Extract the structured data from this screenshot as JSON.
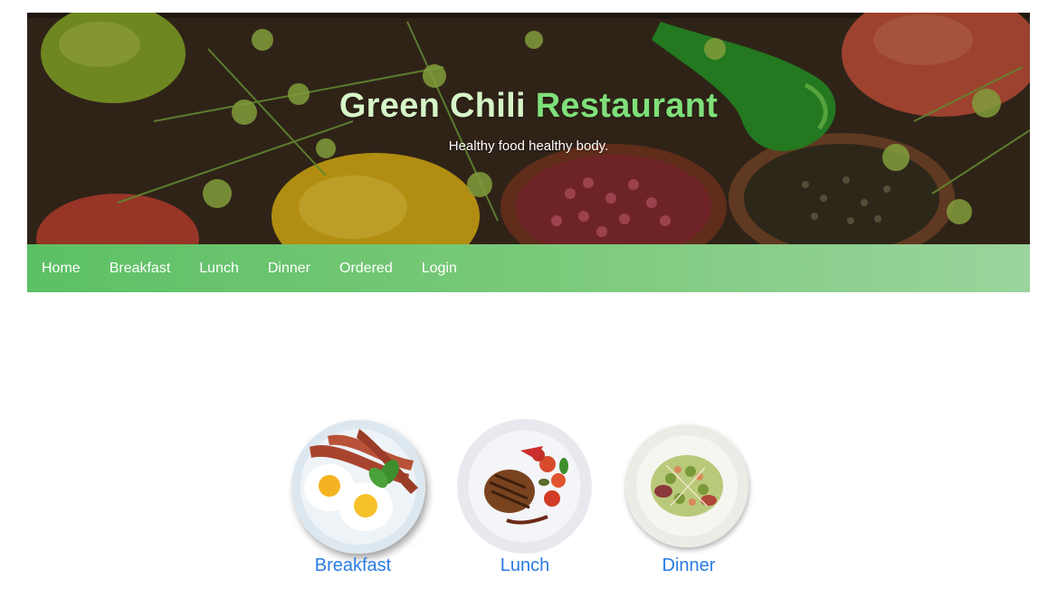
{
  "header": {
    "title_part1": "Green Chili",
    "title_part2": "Restaurant",
    "tagline": "Healthy food healthy body."
  },
  "nav": {
    "items": [
      {
        "label": "Home"
      },
      {
        "label": "Breakfast"
      },
      {
        "label": "Lunch"
      },
      {
        "label": "Dinner"
      },
      {
        "label": "Ordered"
      },
      {
        "label": "Login"
      }
    ]
  },
  "meals": [
    {
      "label": "Breakfast",
      "image": "breakfast-plate-image"
    },
    {
      "label": "Lunch",
      "image": "lunch-plate-image"
    },
    {
      "label": "Dinner",
      "image": "dinner-plate-image"
    }
  ],
  "colors": {
    "title_light": "#d6f5c8",
    "title_accent": "#7fe07a",
    "nav_start": "#5cc064",
    "nav_end": "#9bd49c",
    "link": "#2a7be4"
  }
}
